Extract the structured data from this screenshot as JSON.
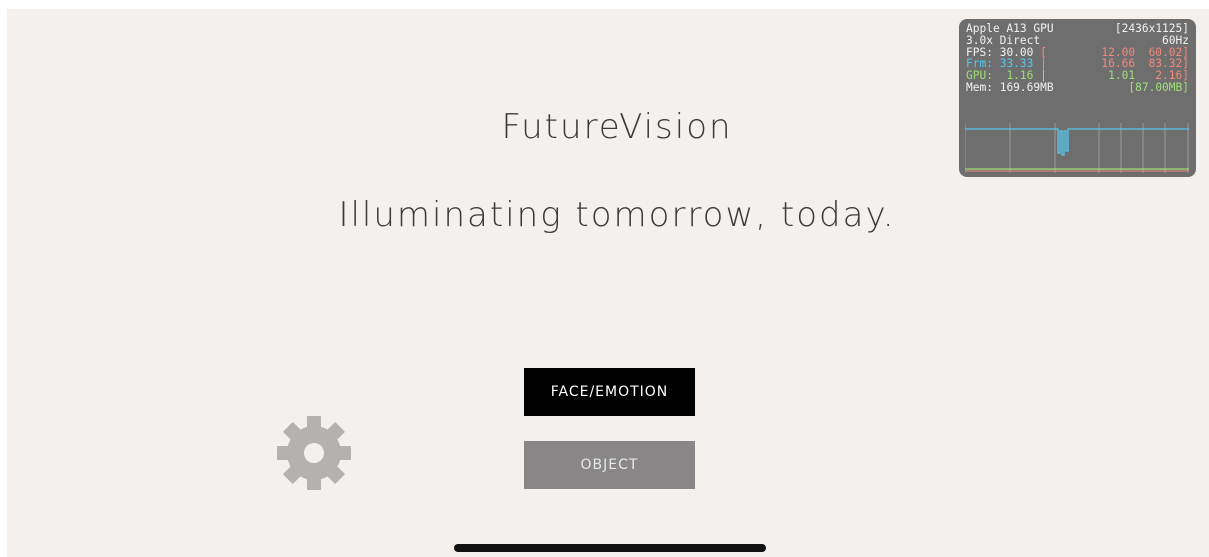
{
  "app": {
    "title": "FutureVision",
    "tagline": "Illuminating tomorrow, today."
  },
  "buttons": {
    "face_emotion": "FACE/EMOTION",
    "object": "OBJECT"
  },
  "icons": {
    "settings": "gear-icon"
  },
  "stats_overlay": {
    "gpu_name": "Apple A13 GPU",
    "resolution": "[2436x1125]",
    "scale_mode": "3.0x Direct",
    "refresh_rate": "60Hz",
    "fps": {
      "label": "FPS:",
      "value": "30.00",
      "bracket_open": "[",
      "min": "12.00",
      "max": "60.02",
      "bracket_close": "]"
    },
    "frame": {
      "label": "Frm:",
      "value": "33.33",
      "separator": "|",
      "min": "16.66",
      "max": "83.32",
      "bracket_close": "]"
    },
    "gpu": {
      "label": "GPU:",
      "value": "1.16",
      "separator": "|",
      "min": "1.01",
      "max": "2.16",
      "bracket_close": "]"
    },
    "mem": {
      "label": "Mem:",
      "value": "169.69MB",
      "extra": "[87.00MB]"
    },
    "colors": {
      "fps": "#f08a7c",
      "frame": "#56c8ee",
      "gpu": "#9fe07a"
    }
  },
  "colors": {
    "background": "#f3f0ee",
    "primary_button": "#000000",
    "secondary_button": "#888686",
    "gear": "#b4b2b0"
  }
}
